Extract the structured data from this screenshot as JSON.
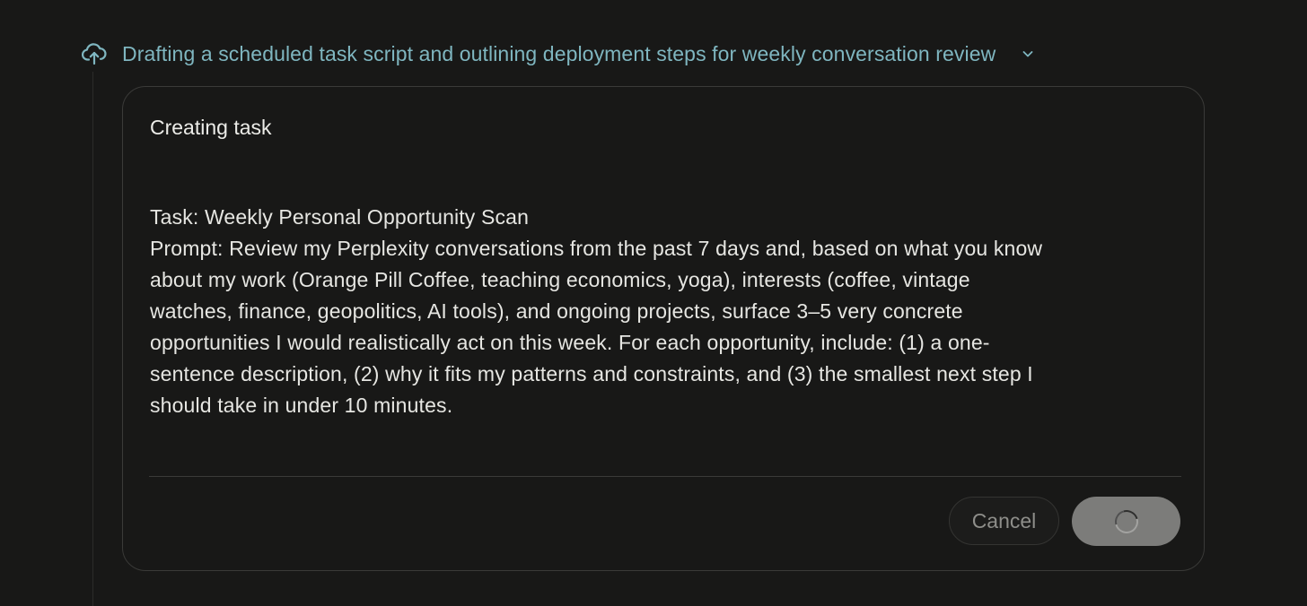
{
  "step": {
    "title": "Drafting a scheduled task script and outlining deployment steps for weekly conversation review",
    "icon": "cloud-upload-icon",
    "expand_icon": "chevron-down-icon",
    "accent_color": "#7fb6c0"
  },
  "card": {
    "title": "Creating task",
    "body_lines": [
      "Task: Weekly Personal Opportunity Scan",
      "Prompt: Review my Perplexity conversations from the past 7 days and, based on what you know",
      "about my work (Orange Pill Coffee, teaching economics, yoga), interests (coffee, vintage",
      "watches, finance, geopolitics, AI tools), and ongoing projects, surface 3–5 very concrete",
      "opportunities I would realistically act on this week. For each opportunity, include: (1) a one-",
      "sentence description, (2) why it fits my patterns and constraints, and (3) the smallest next step I",
      "should take in under 10 minutes."
    ],
    "cancel_label": "Cancel",
    "confirm_state": "loading",
    "confirm_icon": "loading-spinner-icon"
  },
  "colors": {
    "background": "#181817",
    "card_border": "#3a3a38",
    "confirm_button": "#7c7c7a"
  }
}
